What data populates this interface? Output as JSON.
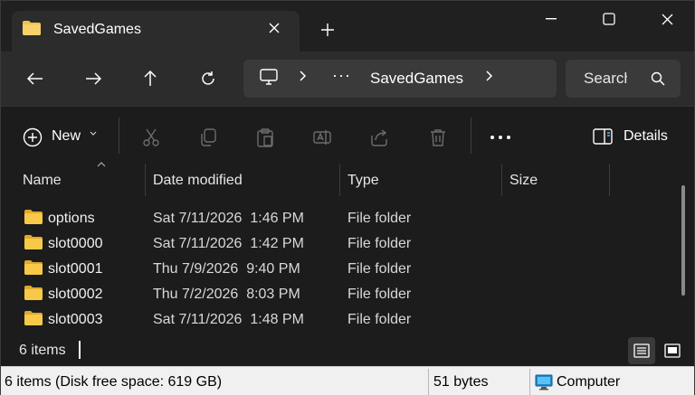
{
  "tab": {
    "title": "SavedGames",
    "close_icon": "close-icon"
  },
  "titlebar": {
    "new_tab_icon": "plus-icon",
    "minimize_icon": "minimize-icon",
    "maximize_icon": "maximize-icon",
    "close_icon": "close-icon"
  },
  "address": {
    "more": "···",
    "crumb": "SavedGames",
    "search_placeholder": "Search SavedGames"
  },
  "toolbar": {
    "new_label": "New",
    "details_label": "Details"
  },
  "columns": [
    "Name",
    "Date modified",
    "Type",
    "Size"
  ],
  "files": [
    {
      "name": "options",
      "date": "Sat 7/11/2026  1:46 PM",
      "type": "File folder"
    },
    {
      "name": "slot0000",
      "date": "Sat 7/11/2026  1:42 PM",
      "type": "File folder"
    },
    {
      "name": "slot0001",
      "date": "Thu 7/9/2026  9:40 PM",
      "type": "File folder"
    },
    {
      "name": "slot0002",
      "date": "Thu 7/2/2026  8:03 PM",
      "type": "File folder"
    },
    {
      "name": "slot0003",
      "date": "Sat 7/11/2026  1:48 PM",
      "type": "File folder"
    }
  ],
  "window_status": {
    "item_count": "6 items"
  },
  "statusbar": {
    "summary": "6 items (Disk free space: 619 GB)",
    "size": "51 bytes",
    "location": "Computer"
  },
  "colors": {
    "folder": "#f3c14b",
    "accent": "#4cc2ff"
  }
}
